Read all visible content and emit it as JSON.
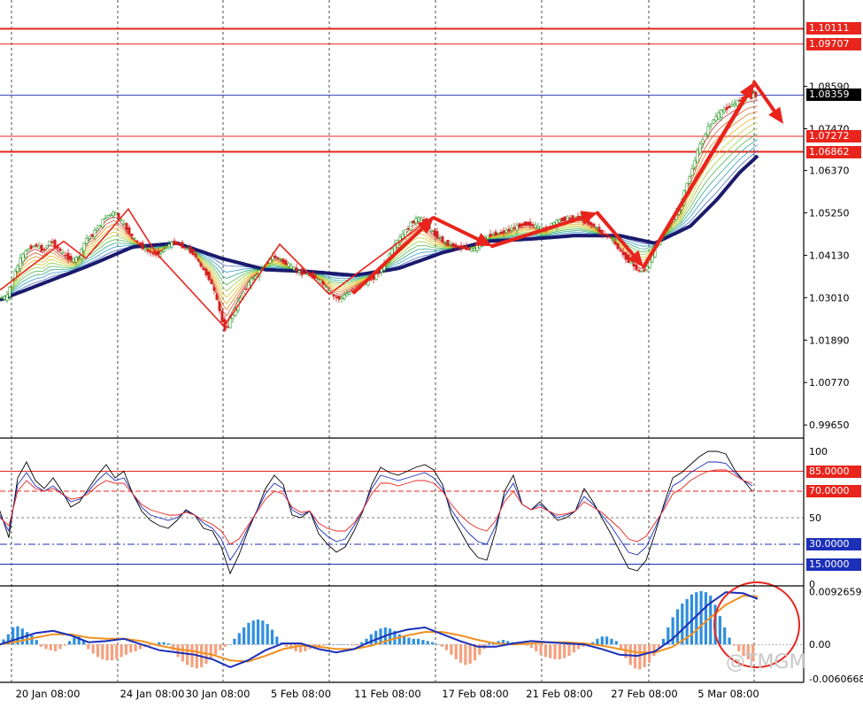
{
  "colors": {
    "up_candle": "#2a9a2a",
    "down_candle": "#d42020",
    "level_line": "#e8241c",
    "price_line": "#1b2fb8",
    "ma_slow": "#1a1a6e",
    "rsi_fast": "#000000",
    "rsi_mid": "#1b2fb8",
    "rsi_slow": "#e8241c",
    "hist_pos": "#2f8fde",
    "hist_neg": "#f5a07e",
    "macd_line": "#1b2fb8",
    "signal_line": "#f09020",
    "arrow": "#e8241c"
  },
  "watermark": "@TMGM",
  "chart_data": [
    {
      "type": "candlestick",
      "title": "",
      "x_labels": [
        "20 Jan 08:00",
        "24 Jan 08:00",
        "30 Jan 08:00",
        "5 Feb 08:00",
        "11 Feb 08:00",
        "17 Feb 08:00",
        "21 Feb 08:00",
        "27 Feb 08:00",
        "5 Mar 08:00"
      ],
      "y_ticks": [
        1.0859,
        1.0747,
        1.0637,
        1.0525,
        1.0413,
        1.0301,
        1.0189,
        1.0077,
        0.9965
      ],
      "y_tick_labels": [
        "1.08590",
        "1.07470",
        "1.06370",
        "1.05250",
        "1.04130",
        "1.03010",
        "1.01890",
        "1.00770",
        "0.99650"
      ],
      "ylim": [
        0.9935,
        1.1087
      ],
      "grid": true,
      "price_path": {
        "t": [
          0,
          8,
          15,
          24,
          33,
          41,
          49,
          57,
          66,
          75,
          84,
          91,
          97,
          104,
          112,
          120,
          130,
          140,
          147,
          156,
          166,
          175,
          183,
          190,
          198,
          206,
          213,
          220,
          228,
          236,
          242,
          247,
          251,
          255,
          259,
          267,
          275,
          283,
          292,
          300,
          308,
          316,
          324,
          332,
          340,
          348,
          356,
          364,
          370,
          376,
          384,
          392,
          400,
          408,
          416,
          424,
          432,
          440,
          448,
          456,
          464,
          472,
          480,
          488,
          496,
          504,
          512,
          520,
          528,
          536,
          544,
          552,
          560,
          568,
          576,
          584,
          592,
          600,
          608,
          616,
          624,
          632,
          640,
          648,
          656,
          664,
          672,
          680,
          688,
          696,
          702,
          708,
          713,
          718,
          723,
          728,
          733,
          738,
          745,
          752,
          760,
          768,
          775,
          782,
          789,
          796,
          803,
          810,
          817,
          824,
          831,
          838,
          845,
          852
        ],
        "p": [
          1.0301,
          1.0301,
          1.0355,
          1.0405,
          1.0432,
          1.044,
          1.0425,
          1.0452,
          1.043,
          1.041,
          1.0399,
          1.0415,
          1.0455,
          1.0465,
          1.049,
          1.0515,
          1.0527,
          1.0495,
          1.047,
          1.0445,
          1.0425,
          1.0415,
          1.0422,
          1.044,
          1.0446,
          1.0437,
          1.0428,
          1.0415,
          1.038,
          1.0355,
          1.032,
          1.028,
          1.024,
          1.0215,
          1.0235,
          1.0275,
          1.0315,
          1.0345,
          1.0365,
          1.039,
          1.041,
          1.0405,
          1.039,
          1.0378,
          1.0367,
          1.0362,
          1.0355,
          1.034,
          1.0322,
          1.0305,
          1.0298,
          1.031,
          1.0322,
          1.0336,
          1.0345,
          1.0356,
          1.038,
          1.041,
          1.0445,
          1.047,
          1.0495,
          1.0512,
          1.0502,
          1.0475,
          1.046,
          1.0445,
          1.0438,
          1.0434,
          1.043,
          1.0428,
          1.0445,
          1.0465,
          1.047,
          1.0474,
          1.0481,
          1.0488,
          1.0496,
          1.0495,
          1.0486,
          1.048,
          1.0495,
          1.0505,
          1.051,
          1.0512,
          1.0513,
          1.05,
          1.049,
          1.047,
          1.0465,
          1.044,
          1.042,
          1.0405,
          1.0392,
          1.038,
          1.037,
          1.0372,
          1.039,
          1.0418,
          1.0448,
          1.0478,
          1.0509,
          1.0535,
          1.059,
          1.064,
          1.069,
          1.073,
          1.076,
          1.078,
          1.0795,
          1.0805,
          1.0815,
          1.0825,
          1.0835,
          1.0836
        ]
      },
      "slow_ma": {
        "t": [
          0,
          50,
          100,
          150,
          200,
          250,
          300,
          350,
          400,
          450,
          500,
          550,
          600,
          650,
          700,
          740,
          780,
          810,
          835,
          858
        ],
        "p": [
          1.0295,
          1.034,
          1.0385,
          1.0435,
          1.0445,
          1.0405,
          1.0375,
          1.037,
          1.036,
          1.0378,
          1.042,
          1.045,
          1.0456,
          1.0465,
          1.0465,
          1.0445,
          1.049,
          1.056,
          1.063,
          1.068
        ]
      },
      "horizontal_levels": [
        {
          "label": "1.10111",
          "value": 1.10111,
          "style": "solid-thick",
          "tag": "red"
        },
        {
          "label": "1.09707",
          "value": 1.09707,
          "style": "solid",
          "tag": "red"
        },
        {
          "label": "1.08359",
          "value": 1.08359,
          "style": "price-line",
          "tag": "black"
        },
        {
          "label": "1.07272",
          "value": 1.07272,
          "style": "solid",
          "tag": "red"
        },
        {
          "label": "1.06862",
          "value": 1.06862,
          "style": "solid-thick",
          "tag": "red"
        }
      ],
      "zigzag": {
        "t": [
          0,
          72,
          97,
          145,
          176,
          253,
          316,
          372,
          488,
          555,
          673,
          728,
          853
        ],
        "p": [
          1.0321,
          1.045,
          1.0405,
          1.0535,
          1.042,
          1.0225,
          1.0442,
          1.031,
          1.0513,
          1.044,
          1.0525,
          1.038,
          1.0865
        ]
      },
      "arrows": [
        {
          "from_t": 400,
          "from_p": 1.0315,
          "to_t": 490,
          "to_p": 1.0512
        },
        {
          "from_t": 490,
          "from_p": 1.0512,
          "to_t": 556,
          "to_p": 1.0437
        },
        {
          "from_t": 556,
          "from_p": 1.0437,
          "to_t": 675,
          "to_p": 1.0525
        },
        {
          "from_t": 675,
          "from_p": 1.0525,
          "to_t": 727,
          "to_p": 1.0382
        },
        {
          "from_t": 727,
          "from_p": 1.0382,
          "to_t": 852,
          "to_p": 1.087
        },
        {
          "from_t": 852,
          "from_p": 1.087,
          "to_t": 885,
          "to_p": 1.076
        }
      ]
    },
    {
      "type": "line",
      "title": "",
      "y_tick_labels": [
        "100",
        "50",
        "0"
      ],
      "y_ticks": [
        100,
        50,
        0
      ],
      "ylim": [
        0,
        108
      ],
      "levels": [
        {
          "label": "85.0000",
          "value": 85,
          "tag": "red",
          "style": "solid"
        },
        {
          "label": "70.0000",
          "value": 70,
          "tag": "red",
          "style": "dashed"
        },
        {
          "label": "30.0000",
          "value": 30,
          "tag": "blue",
          "style": "dashdot"
        },
        {
          "label": "15.0000",
          "value": 15,
          "tag": "blue",
          "style": "solid"
        }
      ],
      "x": [
        0,
        10,
        20,
        30,
        40,
        50,
        60,
        70,
        80,
        90,
        100,
        110,
        120,
        130,
        140,
        150,
        160,
        170,
        180,
        190,
        200,
        210,
        220,
        230,
        240,
        250,
        260,
        270,
        280,
        290,
        300,
        310,
        320,
        330,
        340,
        350,
        360,
        370,
        380,
        390,
        400,
        410,
        420,
        430,
        440,
        450,
        460,
        470,
        480,
        490,
        500,
        510,
        520,
        530,
        540,
        550,
        560,
        570,
        580,
        590,
        600,
        610,
        620,
        630,
        640,
        650,
        660,
        670,
        680,
        690,
        700,
        710,
        720,
        730,
        740,
        750,
        760,
        770,
        780,
        790,
        800,
        810,
        820,
        830,
        840,
        850
      ],
      "series": [
        {
          "values": [
            55,
            35,
            80,
            92,
            78,
            72,
            80,
            70,
            58,
            62,
            72,
            82,
            90,
            80,
            85,
            68,
            55,
            48,
            44,
            42,
            48,
            56,
            52,
            42,
            40,
            28,
            8,
            22,
            40,
            55,
            72,
            82,
            75,
            52,
            50,
            55,
            38,
            30,
            24,
            28,
            40,
            55,
            75,
            88,
            84,
            82,
            85,
            88,
            90,
            86,
            75,
            52,
            40,
            28,
            20,
            18,
            40,
            70,
            82,
            60,
            56,
            62,
            55,
            48,
            50,
            55,
            72,
            62,
            50,
            38,
            25,
            12,
            10,
            18,
            38,
            60,
            80,
            84,
            90,
            96,
            100,
            100,
            98,
            86,
            78,
            70
          ]
        },
        {
          "values": [
            52,
            40,
            75,
            84,
            74,
            70,
            74,
            68,
            62,
            64,
            70,
            78,
            84,
            78,
            80,
            68,
            58,
            52,
            50,
            48,
            50,
            55,
            52,
            46,
            42,
            34,
            18,
            28,
            42,
            55,
            68,
            76,
            72,
            56,
            52,
            55,
            42,
            36,
            32,
            34,
            44,
            56,
            72,
            82,
            80,
            78,
            80,
            82,
            84,
            80,
            72,
            56,
            46,
            38,
            32,
            30,
            44,
            66,
            76,
            60,
            56,
            60,
            55,
            50,
            52,
            55,
            66,
            60,
            52,
            44,
            34,
            24,
            22,
            28,
            42,
            58,
            74,
            78,
            84,
            88,
            92,
            92,
            91,
            84,
            78,
            74
          ]
        },
        {
          "values": [
            50,
            44,
            70,
            78,
            72,
            70,
            72,
            68,
            64,
            65,
            68,
            74,
            78,
            76,
            76,
            68,
            60,
            56,
            54,
            52,
            52,
            54,
            52,
            48,
            45,
            40,
            30,
            34,
            44,
            54,
            64,
            70,
            68,
            58,
            54,
            55,
            46,
            42,
            40,
            40,
            46,
            56,
            68,
            76,
            76,
            74,
            76,
            78,
            78,
            76,
            70,
            60,
            52,
            46,
            42,
            40,
            48,
            62,
            70,
            60,
            56,
            58,
            55,
            52,
            53,
            55,
            62,
            58,
            54,
            48,
            42,
            34,
            32,
            36,
            46,
            56,
            68,
            72,
            78,
            82,
            85,
            86,
            86,
            82,
            78,
            76
          ]
        }
      ]
    },
    {
      "type": "bar",
      "title": "",
      "y_tick_labels": [
        "0.0092659",
        "0.00",
        "-0.0060668"
      ],
      "y_ticks": [
        0.0092659,
        0.0,
        -0.0060668
      ],
      "ylim": [
        -0.0065,
        0.01
      ],
      "histogram": {
        "x0": 4,
        "dx": 4,
        "values": [
          0.0009,
          0.0018,
          0.003,
          0.0032,
          0.0028,
          0.0022,
          0.0016,
          0.0008,
          -0.0004,
          -0.0008,
          -0.001,
          -0.0012,
          -0.0008,
          -0.0002,
          0.0006,
          0.0012,
          0.0016,
          0.0008,
          -0.0008,
          -0.0016,
          -0.0022,
          -0.0026,
          -0.0028,
          -0.0028,
          -0.0026,
          -0.0022,
          -0.0018,
          -0.0014,
          -0.0012,
          -0.0008,
          -0.0004,
          -0.0002,
          0.0002,
          0.0004,
          0.0004,
          0.0002,
          -0.001,
          -0.0022,
          -0.003,
          -0.0036,
          -0.004,
          -0.0042,
          -0.004,
          -0.0034,
          -0.0026,
          -0.0018,
          -0.001,
          -0.0004,
          0.0,
          0.001,
          0.002,
          0.003,
          0.0038,
          0.0042,
          0.0044,
          0.0042,
          0.0036,
          0.0026,
          0.0014,
          0.0004,
          -0.0004,
          -0.0008,
          -0.0012,
          -0.0014,
          -0.0012,
          -0.0008,
          -0.0006,
          -0.0004,
          -0.0002,
          0.0,
          0.0,
          0.0,
          0.0,
          0.0,
          -0.0002,
          -0.0002,
          0.0004,
          0.001,
          0.0018,
          0.0024,
          0.0028,
          0.003,
          0.0028,
          0.0024,
          0.0018,
          0.0014,
          0.0012,
          0.001,
          0.001,
          0.0008,
          0.0006,
          0.0004,
          0.0,
          -0.0004,
          -0.001,
          -0.0018,
          -0.0026,
          -0.0032,
          -0.0036,
          -0.0034,
          -0.0028,
          -0.0018,
          -0.0008,
          0.0002,
          0.0004,
          0.0006,
          0.0008,
          0.0006,
          0.0004,
          0.0002,
          0.0,
          -0.0002,
          -0.0006,
          -0.0012,
          -0.0018,
          -0.0022,
          -0.0024,
          -0.0026,
          -0.0026,
          -0.0024,
          -0.002,
          -0.0014,
          -0.0008,
          -0.0004,
          -0.0002,
          0.0004,
          0.001,
          0.0014,
          0.0014,
          0.001,
          0.0006,
          -0.001,
          -0.0024,
          -0.0036,
          -0.0042,
          -0.0044,
          -0.004,
          -0.0032,
          -0.002,
          -0.0006,
          0.001,
          0.003,
          0.0048,
          0.0062,
          0.0072,
          0.008,
          0.0088,
          0.0092,
          0.0094,
          0.0092,
          0.0086,
          0.007,
          0.005,
          0.003,
          0.0012,
          -0.0002,
          -0.0012,
          -0.002,
          -0.0026,
          -0.003
        ]
      },
      "lines": {
        "x": [
          0,
          20,
          40,
          60,
          80,
          100,
          120,
          140,
          160,
          180,
          200,
          220,
          240,
          260,
          280,
          300,
          320,
          340,
          360,
          380,
          400,
          420,
          440,
          460,
          480,
          500,
          520,
          540,
          560,
          580,
          600,
          620,
          640,
          660,
          680,
          700,
          720,
          740,
          760,
          780,
          800,
          820,
          840,
          856
        ],
        "macd": [
          0.0,
          0.001,
          0.002,
          0.0024,
          0.0016,
          0.0004,
          0.0006,
          0.001,
          0.0,
          -0.001,
          -0.0014,
          -0.0018,
          -0.0026,
          -0.004,
          -0.0028,
          -0.001,
          0.0002,
          0.0002,
          -0.0008,
          -0.0014,
          -0.0008,
          0.0006,
          0.0018,
          0.0026,
          0.003,
          0.0018,
          0.0006,
          -0.0004,
          -0.0004,
          0.0002,
          0.0006,
          0.0004,
          0.0002,
          0.0,
          -0.0008,
          -0.0018,
          -0.002,
          -0.0012,
          0.001,
          0.004,
          0.007,
          0.0092,
          0.009,
          0.008
        ],
        "signal": [
          0.0,
          0.0005,
          0.0012,
          0.0018,
          0.0018,
          0.0012,
          0.001,
          0.001,
          0.0006,
          -0.0002,
          -0.0008,
          -0.0012,
          -0.0018,
          -0.0028,
          -0.003,
          -0.002,
          -0.0008,
          -0.0002,
          -0.0004,
          -0.0008,
          -0.0008,
          -0.0002,
          0.0008,
          0.0016,
          0.0022,
          0.0022,
          0.0016,
          0.0008,
          0.0002,
          0.0,
          0.0002,
          0.0004,
          0.0004,
          0.0002,
          -0.0002,
          -0.0008,
          -0.0014,
          -0.0014,
          -0.0004,
          0.0016,
          0.0044,
          0.007,
          0.0086,
          0.0084
        ]
      }
    }
  ]
}
